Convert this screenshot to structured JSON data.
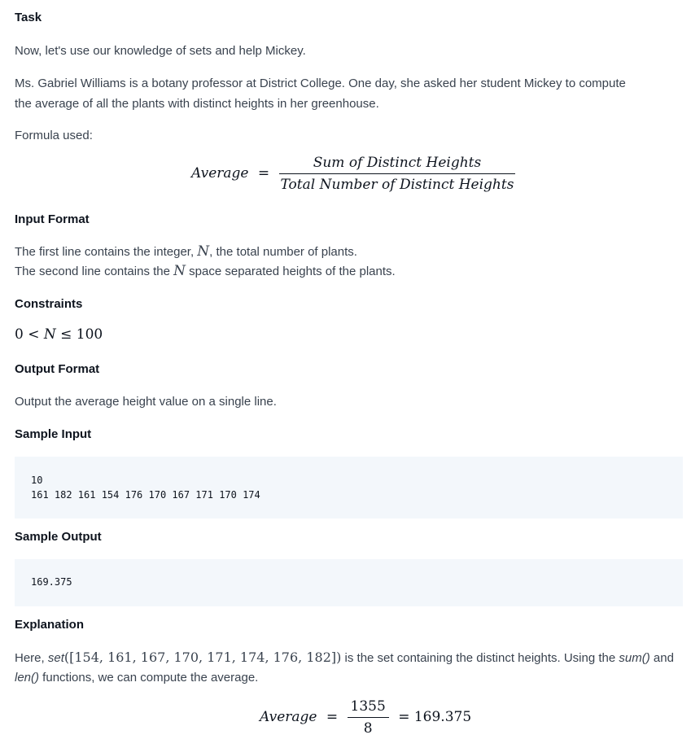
{
  "task": {
    "heading": "Task",
    "intro": "Now, let's use our knowledge of sets and help Mickey.",
    "story_line1": "Ms. Gabriel Williams is a botany professor at District College. One day, she asked her student Mickey to compute",
    "story_line2": "the average of all the plants with distinct heights in her greenhouse.",
    "formula_label": "Formula used:",
    "formula": {
      "lhs": "Average",
      "eq": "=",
      "numerator": "Sum of Distinct Heights",
      "denominator": "Total Number of Distinct Heights"
    }
  },
  "input_format": {
    "heading": "Input Format",
    "line1_a": "The first line contains the integer, ",
    "line1_var": "N",
    "line1_b": ", the total number of plants.",
    "line2_a": "The second line contains the ",
    "line2_var": "N",
    "line2_b": " space separated heights of the plants."
  },
  "constraints": {
    "heading": "Constraints",
    "expr_a": "0 < ",
    "expr_var": "N",
    "expr_b": " ≤ 100"
  },
  "output_format": {
    "heading": "Output Format",
    "text": "Output the average height value on a single line."
  },
  "sample_input": {
    "heading": "Sample Input",
    "line1": "10",
    "line2": "161 182 161 154 176 170 167 171 170 174"
  },
  "sample_output": {
    "heading": "Sample Output",
    "line1": "169.375"
  },
  "explanation": {
    "heading": "Explanation",
    "p1_a": "Here, ",
    "p1_set_fn": "set",
    "p1_set_args": "([154, 161, 167, 170, 171, 174, 176, 182])",
    "p1_b": " is the set containing the distinct heights. Using the ",
    "p1_sum": "sum()",
    "p1_c": " and",
    "p2_len": "len()",
    "p2_rest": " functions, we can compute the average.",
    "formula": {
      "lhs": "Average",
      "eq": "=",
      "numerator": "1355",
      "denominator": "8",
      "result": "= 169.375"
    }
  }
}
